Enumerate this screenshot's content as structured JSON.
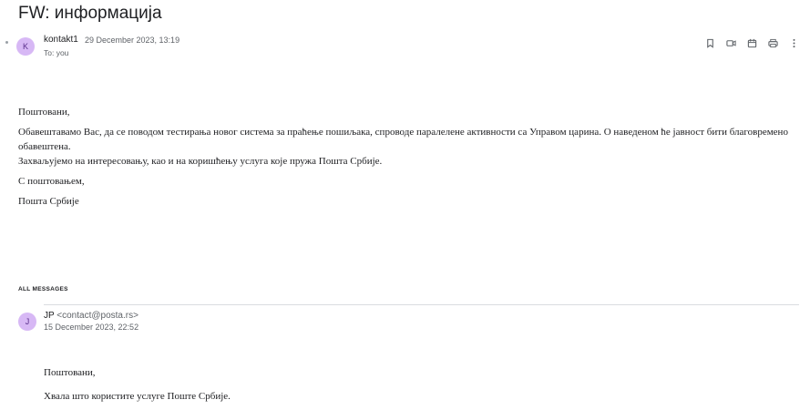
{
  "message": {
    "subject": "FW: информација",
    "avatar_letter": "K",
    "sender": "kontakt1",
    "date": "29 December 2023, 13:19",
    "to": "To: you",
    "body": {
      "greeting": "Поштовани,",
      "line1": "Обавештавамо Вас, да се поводом тестирања новог система за праћење пошиљака, спроводе паралелене активности са Управом царина. О наведеном ће јавност бити благовремено обавештена.",
      "line2": "Захваљујемо на интересовању, као и на коришћењу услуга које пружа Пошта Србије.",
      "regards": "С поштовањем,",
      "signature": "Пошта Србије"
    }
  },
  "toolbar": {
    "icons": [
      "bookmark-icon",
      "video-icon",
      "calendar-icon",
      "print-icon",
      "more-icon"
    ]
  },
  "all_messages_label": "ALL MESSAGES",
  "previous": {
    "avatar_letter": "J",
    "sender_name": "JP",
    "sender_email": "<contact@posta.rs>",
    "date": "15 December 2023, 22:52",
    "body": {
      "greeting": "Поштовани,",
      "line1": "Хвала што користите услуге Поште Србије."
    }
  }
}
